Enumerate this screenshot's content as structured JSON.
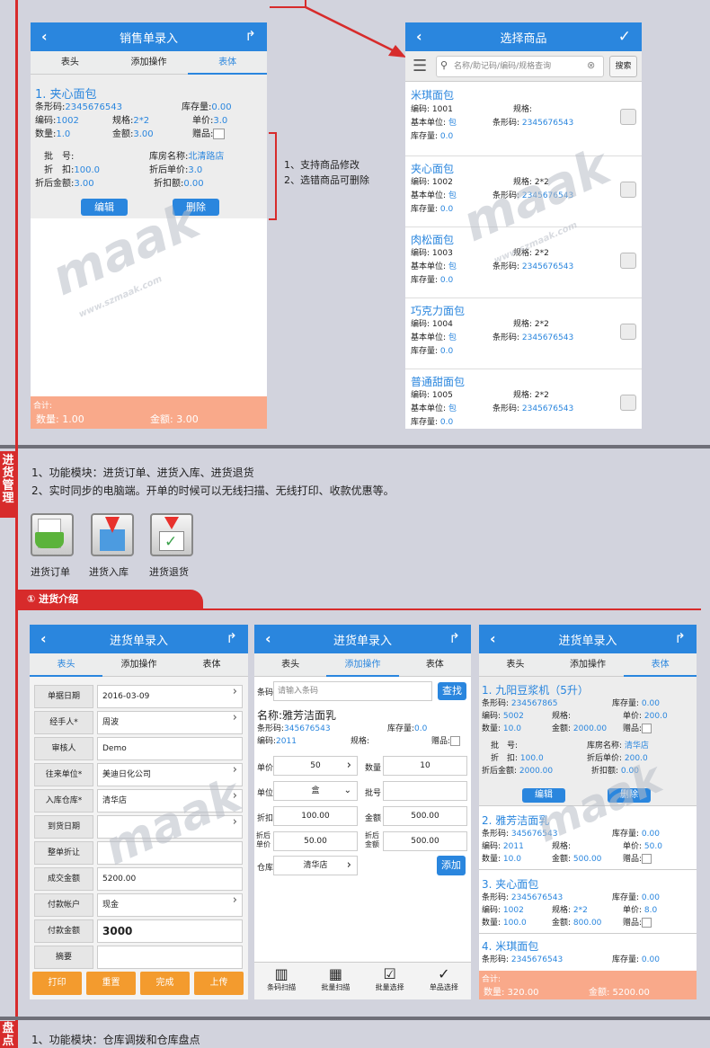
{
  "sales": {
    "title": "销售单录入",
    "tabs": [
      "表头",
      "添加操作",
      "表体"
    ],
    "product_name": "1. 夹心面包",
    "barcode_label": "条形码:",
    "barcode": "2345676543",
    "stock_label": "库存量:",
    "stock": "0.00",
    "code_label": "编码:",
    "code": "1002",
    "spec_label": "规格:",
    "spec": "2*2",
    "price_label": "单价:",
    "price": "3.0",
    "qty_label": "数量:",
    "qty": "1.0",
    "amount_label": "金额:",
    "amount": "3.00",
    "gift_label": "赠品:",
    "batch_label": "批　号:",
    "store_label": "库房名称:",
    "store": "北清路店",
    "disc_label": "折　扣:",
    "disc": "100.0",
    "disc_price_label": "折后单价:",
    "disc_price": "3.0",
    "disc_amount_label": "折后金额:",
    "disc_amount": "3.00",
    "disc_amount2_label": "折扣额:",
    "disc_amount2": "0.00",
    "edit": "编辑",
    "delete": "删除",
    "total_label": "合计:",
    "total_qty": "数量: 1.00",
    "total_amount": "金额: 3.00"
  },
  "annotation": {
    "line1": "1、支持商品修改",
    "line2": "2、选错商品可删除"
  },
  "select": {
    "title": "选择商品",
    "search_placeholder": "名称/助记码/编码/规格查询",
    "search_btn": "搜索",
    "items": [
      {
        "name": "米琪面包",
        "code": "编码: 1001",
        "spec": "规格:",
        "unit": "基本单位:",
        "unit_v": "包",
        "barcode": "条形码:",
        "barcode_v": "2345676543",
        "stock": "库存量:",
        "stock_v": "0.0"
      },
      {
        "name": "夹心面包",
        "code": "编码: 1002",
        "spec": "规格: 2*2",
        "unit": "基本单位:",
        "unit_v": "包",
        "barcode": "条形码:",
        "barcode_v": "2345676543",
        "stock": "库存量:",
        "stock_v": "0.0"
      },
      {
        "name": "肉松面包",
        "code": "编码: 1003",
        "spec": "规格: 2*2",
        "unit": "基本单位:",
        "unit_v": "包",
        "barcode": "条形码:",
        "barcode_v": "2345676543",
        "stock": "库存量:",
        "stock_v": "0.0"
      },
      {
        "name": "巧克力面包",
        "code": "编码: 1004",
        "spec": "规格: 2*2",
        "unit": "基本单位:",
        "unit_v": "包",
        "barcode": "条形码:",
        "barcode_v": "2345676543",
        "stock": "库存量:",
        "stock_v": "0.0"
      },
      {
        "name": "普通甜面包",
        "code": "编码: 1005",
        "spec": "规格: 2*2",
        "unit": "基本单位:",
        "unit_v": "包",
        "barcode": "条形码:",
        "barcode_v": "2345676543",
        "stock": "库存量:",
        "stock_v": "0.0"
      }
    ]
  },
  "purchase_section": {
    "side_label": "进货管理",
    "line1": "1、功能模块：进货订单、进货入库、进货退货",
    "line2": "2、实时同步的电脑端。开单的时候可以无线扫描、无线打印、收款优惠等。",
    "icons": [
      "进货订单",
      "进货入库",
      "进货退货"
    ],
    "intro": "① 进货介绍"
  },
  "p1": {
    "title": "进货单录入",
    "tabs": [
      "表头",
      "添加操作",
      "表体"
    ],
    "rows": [
      [
        "单据日期",
        "2016-03-09"
      ],
      [
        "经手人*",
        "周波"
      ],
      [
        "审核人",
        "Demo"
      ],
      [
        "往来单位*",
        "美迪日化公司"
      ],
      [
        "入库仓库*",
        "清华店"
      ],
      [
        "到货日期",
        ""
      ],
      [
        "整单折让",
        ""
      ],
      [
        "成交金额",
        "5200.00"
      ],
      [
        "付款帐户",
        "现金"
      ],
      [
        "付款金额",
        "3000"
      ],
      [
        "摘要",
        ""
      ]
    ],
    "buttons": [
      "打印",
      "重置",
      "完成",
      "上传"
    ]
  },
  "p2": {
    "title": "进货单录入",
    "tabs": [
      "表头",
      "添加操作",
      "表体"
    ],
    "barcode_label": "条码",
    "barcode_placeholder": "请输入条码",
    "find": "查找",
    "name": "名称:雅芳洁面乳",
    "barcode_l": "条形码:",
    "barcode": "345676543",
    "stock_l": "库存量:",
    "stock": "0.0",
    "code_l": "编码:",
    "code": "2011",
    "spec_l": "规格:",
    "gift_l": "赠品:",
    "price_l": "单价",
    "price": "50",
    "qty_l": "数量",
    "qty": "10",
    "unit_l": "单位",
    "unit": "盒",
    "batch_l": "批号",
    "disc_l": "折扣",
    "disc": "100.00",
    "amount_l": "金额",
    "amount": "500.00",
    "dprice_l": "折后单价",
    "dprice": "50.00",
    "damount_l": "折后金额",
    "damount": "500.00",
    "store_l": "仓库",
    "store": "清华店",
    "add": "添加",
    "nav": [
      "条码扫描",
      "批量扫描",
      "批量选择",
      "单品选择"
    ]
  },
  "p3": {
    "title": "进货单录入",
    "tabs": [
      "表头",
      "添加操作",
      "表体"
    ],
    "i1": {
      "name": "1. 九阳豆浆机（5升）",
      "barcode": "234567865",
      "stock": "0.00",
      "code": "5002",
      "spec": "",
      "price": "200.0",
      "qty": "10.0",
      "amount": "2000.00",
      "store": "清华店",
      "disc": "100.0",
      "dprice": "200.0",
      "damount": "2000.00",
      "damount2": "0.00"
    },
    "i2": {
      "name": "2. 雅芳洁面乳",
      "barcode": "345676543",
      "stock": "0.00",
      "code": "2011",
      "spec": "",
      "price": "50.0",
      "qty": "10.0",
      "amount": "500.00"
    },
    "i3": {
      "name": "3. 夹心面包",
      "barcode": "2345676543",
      "stock": "0.00",
      "code": "1002",
      "spec": "2*2",
      "price": "8.0",
      "qty": "100.0",
      "amount": "800.00"
    },
    "i4": {
      "name": "4. 米琪面包",
      "barcode": "2345676543",
      "stock": "0.00"
    },
    "edit": "编辑",
    "delete": "删除",
    "total_label": "合计:",
    "total_qty": "数量: 320.00",
    "total_amount": "金额: 5200.00"
  },
  "inventory": {
    "side_label": "盘点",
    "line1": "1、功能模块：仓库调拨和仓库盘点"
  },
  "watermark": {
    "brand": "maak",
    "url": "www.szmaak.com"
  }
}
